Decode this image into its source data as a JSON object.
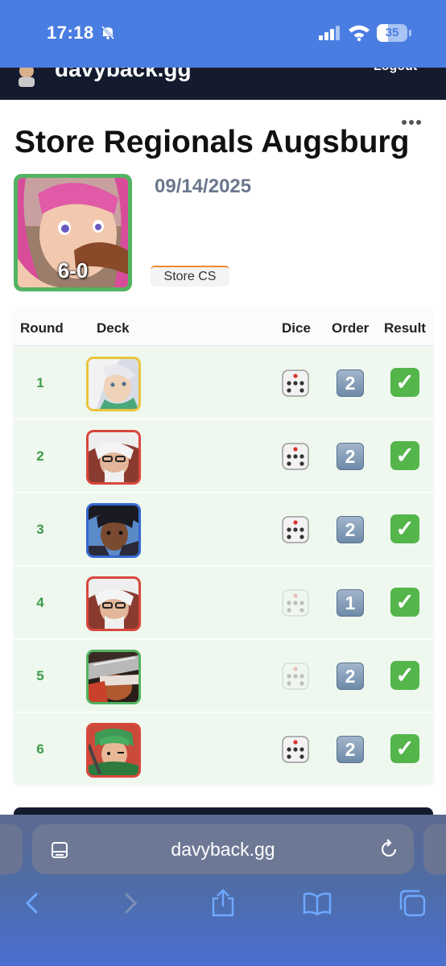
{
  "status_bar": {
    "time": "17:18",
    "battery": "35"
  },
  "site": {
    "title": "davyback.gg",
    "logout": "Logout"
  },
  "event": {
    "title": "Store Regionals Augsburg",
    "date": "09/14/2025",
    "type": "Store CS",
    "record": "6-0"
  },
  "table": {
    "headers": {
      "round": "Round",
      "deck": "Deck",
      "dice": "Dice",
      "order": "Order",
      "result": "Result"
    },
    "rows": [
      {
        "round": "1",
        "deck_color": "yellow",
        "dice_won": true,
        "order": "2",
        "result": "win"
      },
      {
        "round": "2",
        "deck_color": "red",
        "dice_won": true,
        "order": "2",
        "result": "win"
      },
      {
        "round": "3",
        "deck_color": "blue",
        "dice_won": true,
        "order": "2",
        "result": "win"
      },
      {
        "round": "4",
        "deck_color": "red",
        "dice_won": false,
        "order": "1",
        "result": "win"
      },
      {
        "round": "5",
        "deck_color": "green",
        "dice_won": false,
        "order": "2",
        "result": "win"
      },
      {
        "round": "6",
        "deck_color": "red",
        "dice_won": true,
        "order": "2",
        "result": "win"
      }
    ]
  },
  "browser": {
    "url": "davyback.gg"
  },
  "colors": {
    "status_bar": "#4a7de2",
    "header": "#141b2e",
    "win_row": "#eff8ef",
    "round_text": "#3d9a4a",
    "deck_yellow": "#e9c53a",
    "deck_red": "#d9473d",
    "deck_blue": "#3468d1",
    "deck_green": "#52b362"
  }
}
